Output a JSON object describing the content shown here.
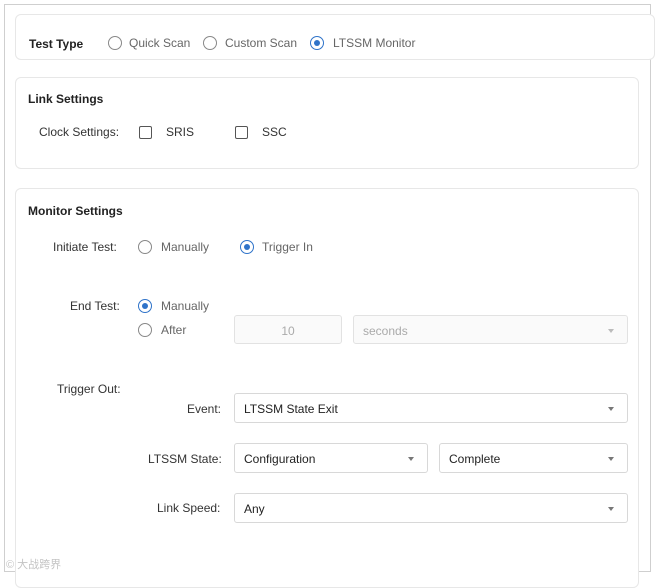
{
  "test_type": {
    "label": "Test Type",
    "options": [
      "Quick Scan",
      "Custom Scan",
      "LTSSM Monitor"
    ],
    "selected": "LTSSM Monitor"
  },
  "link_settings": {
    "title": "Link Settings",
    "clock_label": "Clock Settings:",
    "sris_label": "SRIS",
    "sris_checked": false,
    "ssc_label": "SSC",
    "ssc_checked": false
  },
  "monitor_settings": {
    "title": "Monitor Settings",
    "initiate": {
      "label": "Initiate Test:",
      "options": [
        "Manually",
        "Trigger In"
      ],
      "selected": "Trigger In"
    },
    "end": {
      "label": "End Test:",
      "options": [
        "Manually",
        "After"
      ],
      "selected": "Manually",
      "after_value": "10",
      "unit": "seconds"
    },
    "trigger_out": {
      "label": "Trigger Out:",
      "event_label": "Event:",
      "event_value": "LTSSM State Exit",
      "ltssm_label": "LTSSM State:",
      "ltssm_value": "Configuration",
      "ltssm_sub_value": "Complete",
      "speed_label": "Link Speed:",
      "speed_value": "Any"
    }
  },
  "watermark": "© 大战跨界",
  "colors": {
    "accent": "#2f73c9",
    "border": "#e7e7e7"
  }
}
